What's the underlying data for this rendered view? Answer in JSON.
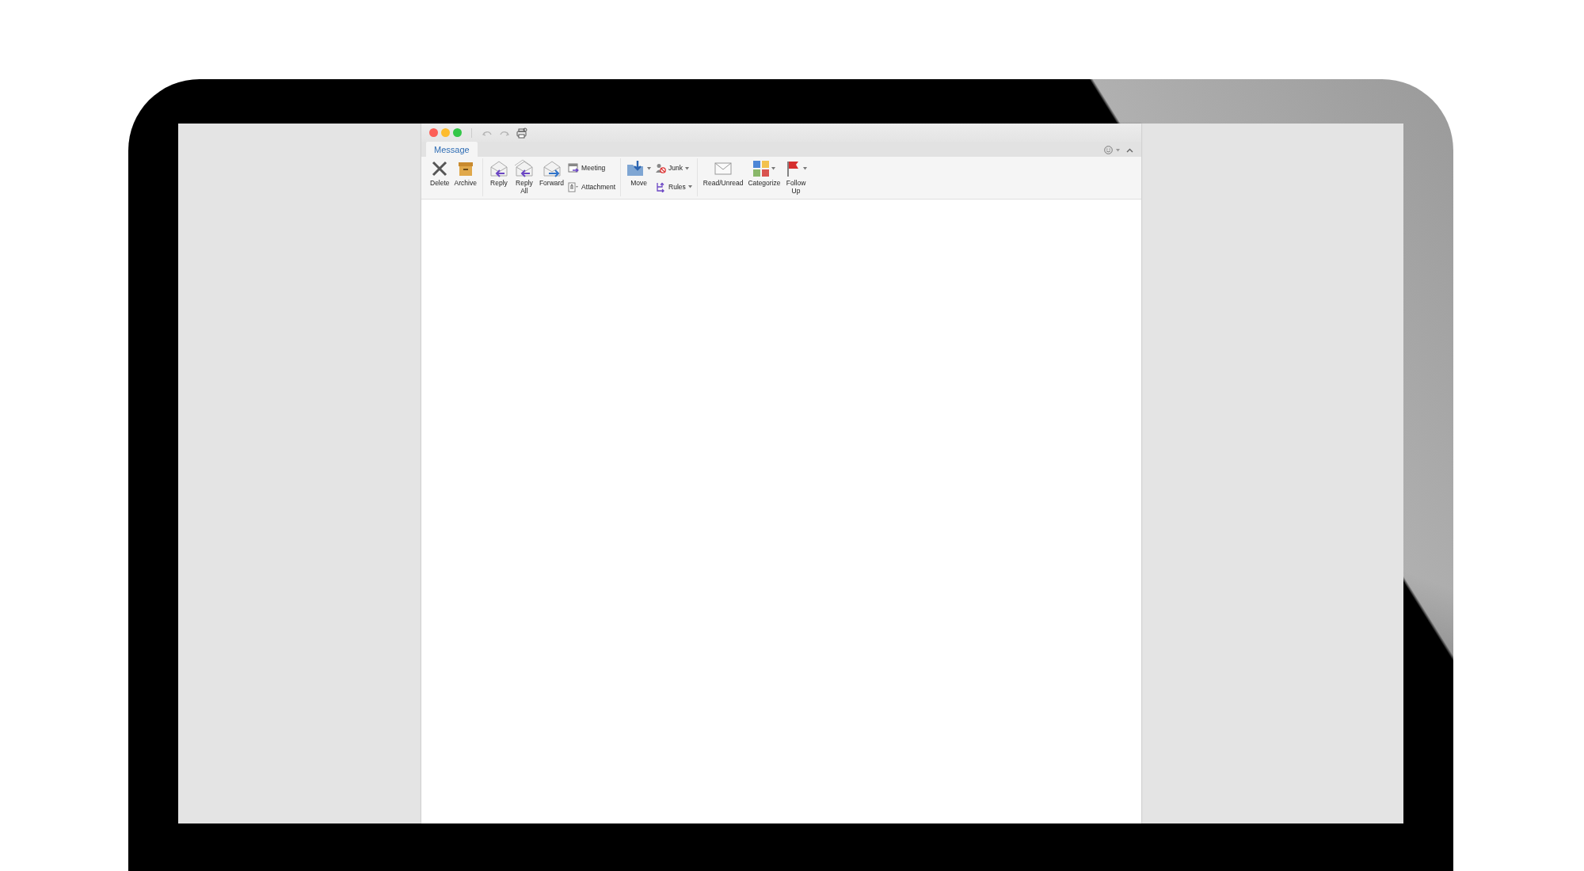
{
  "window": {
    "quick_access": [
      {
        "disabled": true
      },
      {
        "disabled": true
      },
      {
        "disabled": false
      }
    ],
    "tabs": [
      {
        "label": "Message",
        "selected": true
      }
    ],
    "ribbon": {
      "groups": [
        {
          "items": [
            {
              "kind": "large",
              "label": "Delete",
              "dropdown": false
            },
            {
              "kind": "large",
              "label": "Archive",
              "dropdown": false
            }
          ]
        },
        {
          "items": [
            {
              "kind": "large",
              "label": "Reply",
              "dropdown": false
            },
            {
              "kind": "large",
              "label": "Reply All",
              "dropdown": false
            },
            {
              "kind": "large",
              "label": "Forward",
              "dropdown": false
            },
            {
              "kind": "small",
              "label": "Meeting",
              "dropdown": false
            },
            {
              "kind": "small",
              "label": "Attachment",
              "dropdown": false
            }
          ]
        },
        {
          "items": [
            {
              "kind": "large",
              "label": "Move",
              "dropdown": true
            },
            {
              "kind": "small",
              "label": "Junk",
              "dropdown": true
            },
            {
              "kind": "small",
              "label": "Rules",
              "dropdown": true
            }
          ]
        },
        {
          "items": [
            {
              "kind": "large",
              "label": "Read/Unread",
              "dropdown": false
            },
            {
              "kind": "large",
              "label": "Categorize",
              "dropdown": true
            },
            {
              "kind": "large",
              "label": "Follow Up",
              "dropdown": true
            }
          ]
        }
      ]
    }
  }
}
